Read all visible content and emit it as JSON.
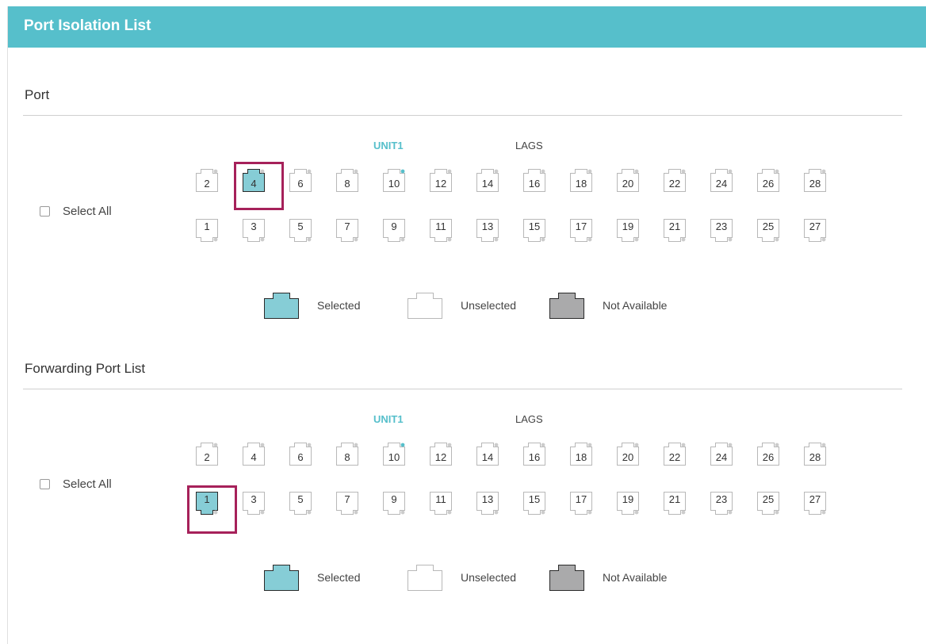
{
  "header": {
    "title": "Port Isolation List"
  },
  "colors": {
    "accent": "#56bfcb",
    "selected_fill": "#86cdd6",
    "not_available_fill": "#aaaaab",
    "highlight": "#a6215a",
    "link_dot": "#56bfcb"
  },
  "sections": [
    {
      "title": "Port",
      "unit_label": "UNIT1",
      "lags_label": "LAGS",
      "select_all_label": "Select All",
      "select_all_checked": false,
      "top_ports": [
        "2",
        "4",
        "6",
        "8",
        "10",
        "12",
        "14",
        "16",
        "18",
        "20",
        "22",
        "24",
        "26",
        "28"
      ],
      "bottom_ports": [
        "1",
        "3",
        "5",
        "7",
        "9",
        "11",
        "13",
        "15",
        "17",
        "19",
        "21",
        "23",
        "25",
        "27"
      ],
      "selected_ports": [
        "4"
      ],
      "link_up_ports": [
        "10"
      ],
      "legend": {
        "selected": "Selected",
        "unselected": "Unselected",
        "not_available": "Not Available"
      }
    },
    {
      "title": "Forwarding Port List",
      "unit_label": "UNIT1",
      "lags_label": "LAGS",
      "select_all_label": "Select All",
      "select_all_checked": false,
      "top_ports": [
        "2",
        "4",
        "6",
        "8",
        "10",
        "12",
        "14",
        "16",
        "18",
        "20",
        "22",
        "24",
        "26",
        "28"
      ],
      "bottom_ports": [
        "1",
        "3",
        "5",
        "7",
        "9",
        "11",
        "13",
        "15",
        "17",
        "19",
        "21",
        "23",
        "25",
        "27"
      ],
      "selected_ports": [
        "1"
      ],
      "link_up_ports": [
        "10"
      ],
      "legend": {
        "selected": "Selected",
        "unselected": "Unselected",
        "not_available": "Not Available"
      }
    }
  ]
}
